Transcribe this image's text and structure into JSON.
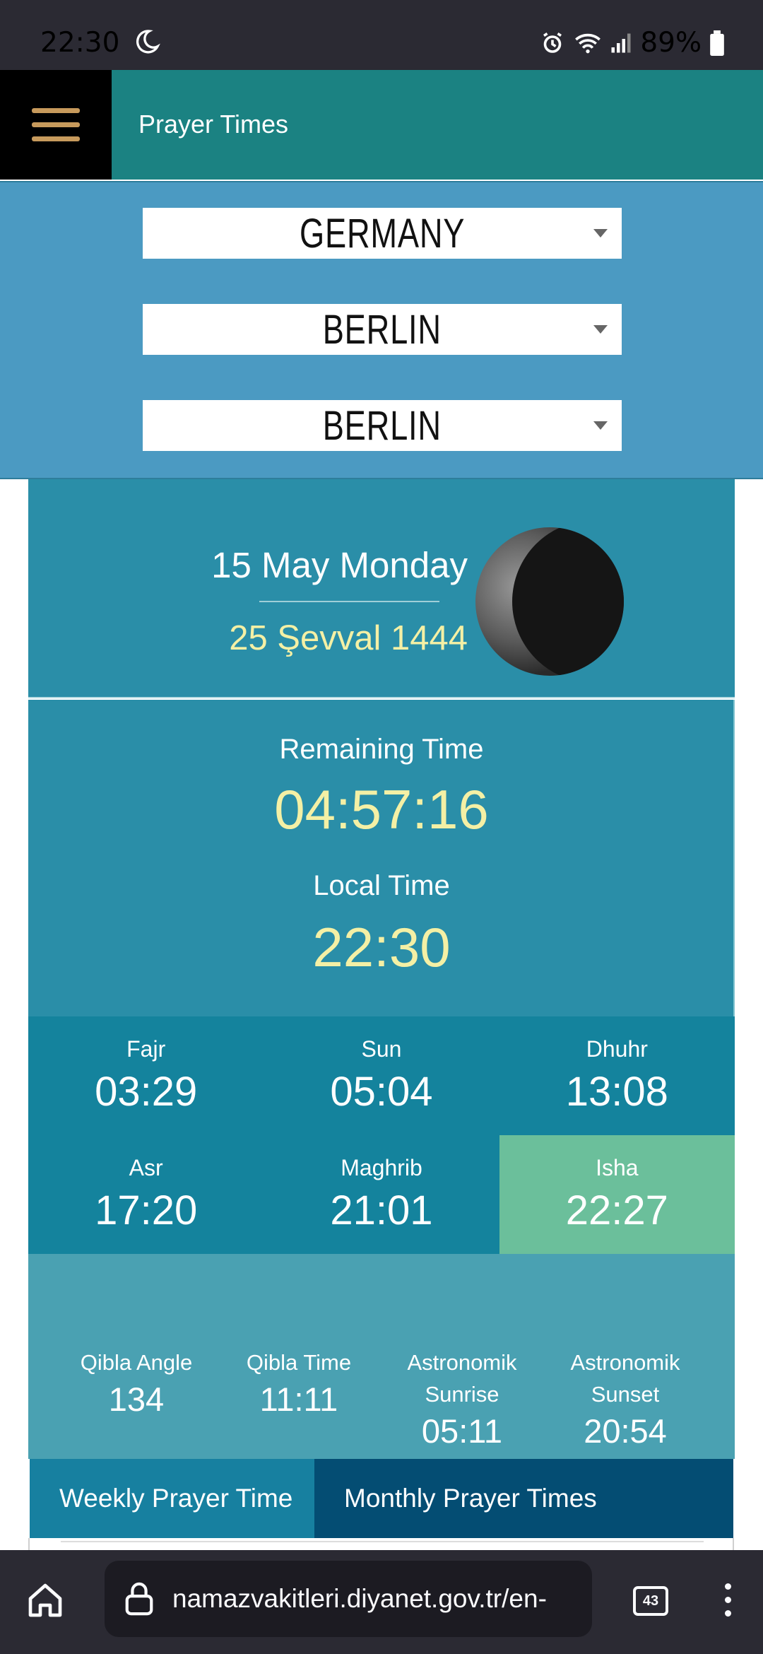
{
  "status_bar": {
    "time": "22:30",
    "battery": "89%"
  },
  "header": {
    "title": "Prayer Times"
  },
  "location": {
    "country": "GERMANY",
    "city": "BERLIN",
    "district": "BERLIN"
  },
  "date": {
    "gregorian": "15 May Monday",
    "hijri": "25 Şevval 1444"
  },
  "timer": {
    "remaining_label": "Remaining Time",
    "remaining_value": "04:57:16",
    "local_label": "Local Time",
    "local_value": "22:30"
  },
  "prayers": [
    {
      "name": "Fajr",
      "time": "03:29"
    },
    {
      "name": "Sun",
      "time": "05:04"
    },
    {
      "name": "Dhuhr",
      "time": "13:08"
    },
    {
      "name": "Asr",
      "time": "17:20"
    },
    {
      "name": "Maghrib",
      "time": "21:01"
    },
    {
      "name": "Isha",
      "time": "22:27"
    }
  ],
  "info": [
    {
      "label": "Qibla Angle",
      "value": "134"
    },
    {
      "label": "Qibla Time",
      "value": "11:11"
    },
    {
      "label_1": "Astronomik",
      "label_2": "Sunrise",
      "value": "05:11"
    },
    {
      "label_1": "Astronomik",
      "label_2": "Sunset",
      "value": "20:54"
    }
  ],
  "tabs": {
    "weekly": "Weekly Prayer Time",
    "monthly": "Monthly Prayer Times"
  },
  "browser": {
    "url": "namazvakitleri.diyanet.gov.tr/en-",
    "tab_count": "43"
  },
  "colors": {
    "header": "#1b8282",
    "select_bg": "#4b9ac2",
    "card": "#2a8ea8",
    "highlight": "#f4f0a5",
    "active_prayer": "#6bbf9b"
  }
}
